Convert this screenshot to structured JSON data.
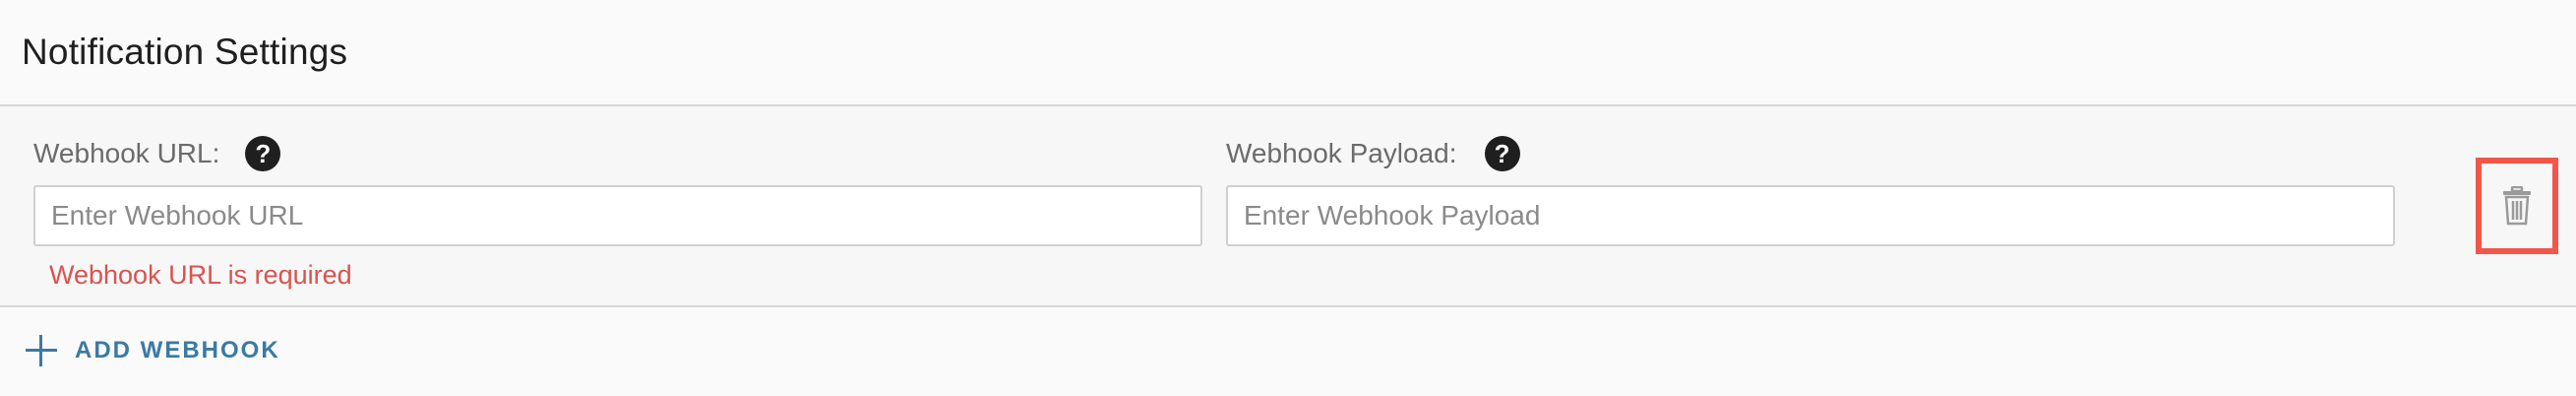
{
  "header": {
    "title": "Notification Settings"
  },
  "webhook": {
    "url": {
      "label": "Webhook URL:",
      "placeholder": "Enter Webhook URL",
      "value": "",
      "error": "Webhook URL is required",
      "help_icon": "question-circle-icon"
    },
    "payload": {
      "label": "Webhook Payload:",
      "placeholder": "Enter Webhook Payload",
      "value": "",
      "help_icon": "question-circle-icon"
    },
    "delete_icon": "trash-icon"
  },
  "footer": {
    "add_label": "ADD WEBHOOK",
    "add_icon": "plus-icon"
  },
  "colors": {
    "accent": "#3a7aa3",
    "error": "#d9534f",
    "highlight": "#f2564b"
  }
}
